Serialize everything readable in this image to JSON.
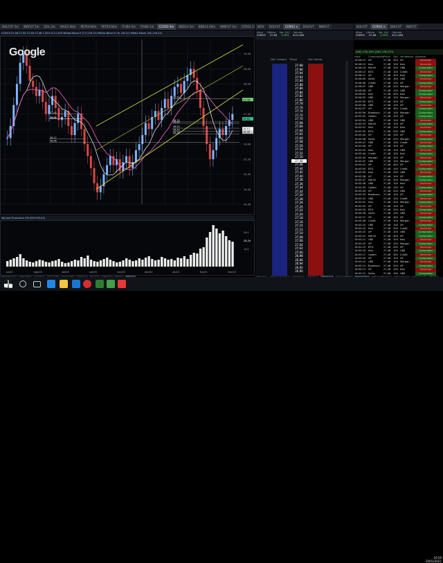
{
  "top_tabs": [
    "DOLFUT 5m",
    "INDFUT 5m",
    "DOL 2m",
    "VALE3 60m",
    "PETR4 60m",
    "PETR4 60m",
    "ITUB4 5m",
    "ITUB4 5m",
    "CCRO3 5m",
    "BBDC4 5m",
    "BBDC4 60m",
    "WINFUT 5m",
    "CCRO3 15m",
    "BBFUT 5m",
    "WDO"
  ],
  "book_tabs": [
    "IBOV",
    "DOLFUT",
    "CCRO3 ×",
    "DOLFUT",
    "INDFUT"
  ],
  "chart_header": "CCRO3:27,48 27,54 27,48 27,48  1,35%  6.11.405  Média Móvel E (17) (26,72)  Média Móvel E (9) (26,51)  Média Móvel (34) (26,24)",
  "watermark": "Google",
  "volume_header": "Volume Financeiro (99.493.939,03)",
  "price_labels_right": [
    "29,00",
    "28,50",
    "28,00",
    "27,50",
    "27,00",
    "26,50",
    "26,00",
    "25,50",
    "25,00",
    "24,50",
    "24,00"
  ],
  "level_labels": [
    "26,17",
    "27,00",
    "26,84",
    "26,84",
    "27,51",
    "26,74",
    "26,69",
    "26,06",
    "26,53",
    "26,43",
    "26,34"
  ],
  "highlight_labels": [
    {
      "text": "27,48",
      "color": "#7c7"
    },
    {
      "text": "26,84",
      "color": "#3b8"
    },
    {
      "text": "26,51",
      "color": "#fff"
    },
    {
      "text": "26,40",
      "color": "#ccc"
    }
  ],
  "volume_label": "28,29",
  "volume_scale": [
    "20,0",
    "10,0"
  ],
  "x_dates": [
    "jul/20",
    "ago/20",
    "set/20",
    "out/20",
    "nov/20",
    "dez/20",
    "jan/21",
    "fev/21",
    "mar/21"
  ],
  "book": {
    "headers": [
      "Qtd. Compra",
      "Preço",
      "Qtd. Venda"
    ],
    "ticker_header": [
      "Ativo",
      "Último",
      "Var. (%)",
      "Volume"
    ],
    "ticker_values": [
      "CCRO3",
      "27,48",
      "1,35%",
      "6.11.405"
    ],
    "prices": [
      "27,98",
      "27,96",
      "27,94",
      "27,92",
      "27,90",
      "27,88",
      "27,86",
      "27,84",
      "27,82",
      "27,80",
      "27,78",
      "27,76",
      "27,74",
      "27,72",
      "27,70",
      "27,68",
      "27,66",
      "27,64",
      "27,62",
      "27,60",
      "27,58",
      "27,56",
      "27,54",
      "27,52",
      "27,50",
      "27,48",
      "27,46",
      "27,44",
      "27,42",
      "27,40",
      "27,38",
      "27,36",
      "27,34",
      "27,32",
      "27,30",
      "27,28",
      "27,26",
      "27,24",
      "27,22",
      "27,20",
      "27,18",
      "27,16",
      "27,14",
      "27,12",
      "27,10",
      "27,08",
      "27,06",
      "27,04",
      "27,02",
      "27,00",
      "26,98",
      "26,96",
      "26,94",
      "26,92",
      "26,90"
    ],
    "bottom_tabs": [
      "Pregão",
      "Profundidade",
      "Gráfico",
      "Ofertas",
      "Ordens",
      "SuperDOM"
    ]
  },
  "times_trades": {
    "headers": [
      "Hora",
      "Compradora",
      "Preço",
      "Qtd",
      "Vendedora",
      "Agressor"
    ],
    "summary": "[462,178] 49%  [481,276] 51%",
    "rows": [
      [
        "16:06:19",
        "XP",
        "27,48",
        "300",
        "XP",
        "Vendedor"
      ],
      [
        "16:06:19",
        "Itaú",
        "27,48",
        "100",
        "Itaú",
        "Vendedor"
      ],
      [
        "16:06:16",
        "Merrill",
        "27,48",
        "200",
        "UBS",
        "Comprador"
      ],
      [
        "16:06:13",
        "BTG",
        "27,48",
        "100",
        "Credit",
        "Vendedor"
      ],
      [
        "16:06:12",
        "XP",
        "27,48",
        "300",
        "Itaú",
        "Comprador"
      ],
      [
        "16:06:09",
        "Safra",
        "27,48",
        "100",
        "UBS",
        "Vendedor"
      ],
      [
        "16:06:08",
        "Credit",
        "27,48",
        "100",
        "XP",
        "Comprador"
      ],
      [
        "16:06:07",
        "UBS",
        "27,48",
        "200",
        "Morgan",
        "Vendedor"
      ],
      [
        "16:06:06",
        "XP",
        "27,48",
        "100",
        "UBS",
        "Comprador"
      ],
      [
        "16:06:05",
        "Itaú",
        "27,48",
        "400",
        "Itaú",
        "Comprador"
      ],
      [
        "16:06:03",
        "UBS",
        "27,48",
        "100",
        "Morgan",
        "Vendedor"
      ],
      [
        "16:05:59",
        "BTG",
        "27,48",
        "200",
        "XP",
        "Comprador"
      ],
      [
        "16:05:58",
        "UBS",
        "27,48",
        "100",
        "XP",
        "Vendedor"
      ],
      [
        "16:05:57",
        "XP",
        "27,48",
        "300",
        "Credit",
        "Comprador"
      ],
      [
        "16:05:56",
        "Bradesco",
        "27,48",
        "100",
        "Morgan",
        "Comprador"
      ],
      [
        "16:05:55",
        "Goldm",
        "27,48",
        "200",
        "XP",
        "Comprador"
      ],
      [
        "16:05:54",
        "UBS",
        "27,48",
        "100",
        "UBS",
        "Vendedor"
      ],
      [
        "16:05:53",
        "Merrill",
        "27,48",
        "100",
        "XP",
        "Comprador"
      ],
      [
        "16:05:51",
        "Itaú",
        "27,48",
        "100",
        "Itaú",
        "Vendedor"
      ],
      [
        "16:05:50",
        "BTG",
        "27,48",
        "500",
        "UBS",
        "Comprador"
      ],
      [
        "16:05:49",
        "XP",
        "27,48",
        "100",
        "XP",
        "Vendedor"
      ],
      [
        "16:05:48",
        "Safra",
        "27,48",
        "200",
        "Morgan",
        "Comprador"
      ],
      [
        "16:05:47",
        "UBS",
        "27,48",
        "100",
        "Credit",
        "Vendedor"
      ],
      [
        "16:05:46",
        "XP",
        "27,48",
        "300",
        "XP",
        "Comprador"
      ],
      [
        "16:05:45",
        "Itaú",
        "27,48",
        "100",
        "UBS",
        "Vendedor"
      ],
      [
        "16:05:44",
        "Credit",
        "27,48",
        "100",
        "Itaú",
        "Comprador"
      ],
      [
        "16:05:43",
        "Morgan",
        "27,48",
        "200",
        "XP",
        "Vendedor"
      ],
      [
        "16:05:42",
        "UBS",
        "27,48",
        "100",
        "Morgan",
        "Comprador"
      ],
      [
        "16:05:41",
        "XP",
        "27,48",
        "400",
        "XP",
        "Vendedor"
      ],
      [
        "16:05:40",
        "BTG",
        "27,48",
        "100",
        "Credit",
        "Comprador"
      ],
      [
        "16:05:39",
        "Itaú",
        "27,48",
        "200",
        "UBS",
        "Vendedor"
      ],
      [
        "16:05:38",
        "XP",
        "27,48",
        "100",
        "XP",
        "Comprador"
      ],
      [
        "16:05:37",
        "Merrill",
        "27,48",
        "300",
        "Morgan",
        "Comprador"
      ],
      [
        "16:05:36",
        "UBS",
        "27,48",
        "100",
        "Itaú",
        "Vendedor"
      ],
      [
        "16:05:35",
        "Goldm",
        "27,48",
        "100",
        "XP",
        "Comprador"
      ],
      [
        "16:05:34",
        "XP",
        "27,48",
        "200",
        "UBS",
        "Vendedor"
      ],
      [
        "16:05:33",
        "Bradesco",
        "27,48",
        "100",
        "XP",
        "Comprador"
      ],
      [
        "16:05:32",
        "UBS",
        "27,48",
        "100",
        "Credit",
        "Vendedor"
      ],
      [
        "16:05:31",
        "Itaú",
        "27,48",
        "500",
        "Morgan",
        "Comprador"
      ],
      [
        "16:05:30",
        "XP",
        "27,48",
        "100",
        "XP",
        "Vendedor"
      ],
      [
        "16:05:29",
        "BTG",
        "27,48",
        "200",
        "Itaú",
        "Comprador"
      ],
      [
        "16:05:28",
        "Safra",
        "27,48",
        "100",
        "UBS",
        "Vendedor"
      ],
      [
        "16:05:27",
        "XP",
        "27,48",
        "300",
        "XP",
        "Comprador"
      ],
      [
        "16:05:26",
        "Credit",
        "27,48",
        "100",
        "Morgan",
        "Vendedor"
      ],
      [
        "16:05:25",
        "UBS",
        "27,48",
        "100",
        "XP",
        "Comprador"
      ],
      [
        "16:05:24",
        "Itaú",
        "27,48",
        "200",
        "Credit",
        "Vendedor"
      ],
      [
        "16:05:23",
        "XP",
        "27,48",
        "100",
        "UBS",
        "Comprador"
      ],
      [
        "16:05:22",
        "Merrill",
        "27,48",
        "400",
        "XP",
        "Comprador"
      ],
      [
        "16:05:21",
        "UBS",
        "27,48",
        "100",
        "Itaú",
        "Vendedor"
      ],
      [
        "16:05:20",
        "XP",
        "27,48",
        "100",
        "Morgan",
        "Comprador"
      ],
      [
        "16:05:19",
        "BTG",
        "27,48",
        "200",
        "XP",
        "Vendedor"
      ],
      [
        "16:05:18",
        "Itaú",
        "27,48",
        "100",
        "UBS",
        "Comprador"
      ],
      [
        "16:05:17",
        "Goldm",
        "27,48",
        "300",
        "Credit",
        "Vendedor"
      ],
      [
        "16:05:16",
        "XP",
        "27,48",
        "100",
        "XP",
        "Comprador"
      ],
      [
        "16:05:15",
        "UBS",
        "27,48",
        "100",
        "Morgan",
        "Vendedor"
      ],
      [
        "16:05:14",
        "Bradesco",
        "27,48",
        "200",
        "XP",
        "Comprador"
      ],
      [
        "16:05:13",
        "XP",
        "27,48",
        "100",
        "Itaú",
        "Vendedor"
      ],
      [
        "16:05:12",
        "Safra",
        "27,48",
        "100",
        "UBS",
        "Comprador"
      ]
    ],
    "bottom_tabs": [
      "Negócios",
      "Times/Trades",
      "Corretoras",
      "Agressor",
      "Book"
    ]
  },
  "left_bottom_tabs": [
    "Mini 5 min",
    "Mini 15",
    "Ivador",
    "Lucro 2",
    "Lucro 3",
    "Ativos",
    "Lucro",
    "Mini 2",
    "Stoc",
    "Novo"
  ],
  "clock": {
    "time": "16:59",
    "date": "20/01/2021"
  },
  "colors": {
    "buy": "#1a237e",
    "sell": "#8b1010",
    "channel": "#c8d640",
    "candle_up": "#7fb5ff",
    "candle_down": "#d94848",
    "volume": "#eeeeee"
  }
}
